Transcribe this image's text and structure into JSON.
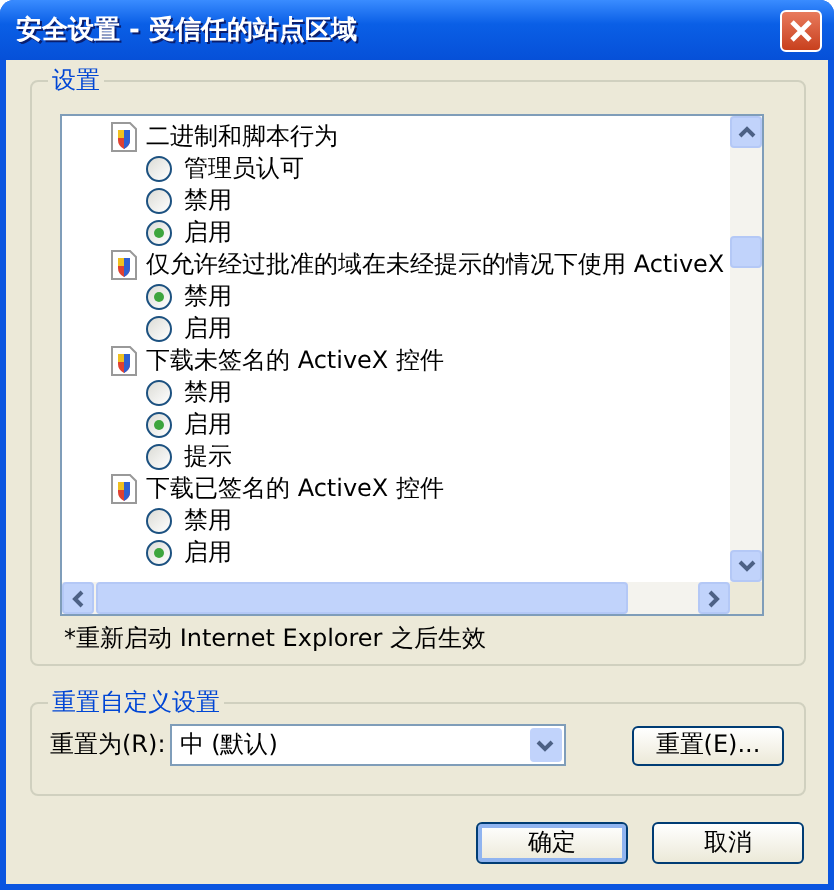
{
  "window": {
    "title": "安全设置 - 受信任的站点区域"
  },
  "settings_group": {
    "label": "设置",
    "items": [
      {
        "label": "二进制和脚本行为",
        "options": [
          {
            "label": "管理员认可",
            "selected": false
          },
          {
            "label": "禁用",
            "selected": false
          },
          {
            "label": "启用",
            "selected": true
          }
        ]
      },
      {
        "label": "仅允许经过批准的域在未经提示的情况下使用 ActiveX",
        "options": [
          {
            "label": "禁用",
            "selected": true
          },
          {
            "label": "启用",
            "selected": false
          }
        ]
      },
      {
        "label": "下载未签名的 ActiveX 控件",
        "options": [
          {
            "label": "禁用",
            "selected": false
          },
          {
            "label": "启用",
            "selected": true
          },
          {
            "label": "提示",
            "selected": false
          }
        ]
      },
      {
        "label": "下载已签名的 ActiveX 控件",
        "options": [
          {
            "label": "禁用",
            "selected": false
          },
          {
            "label": "启用",
            "selected": true
          }
        ]
      }
    ],
    "note": "*重新启动 Internet Explorer 之后生效"
  },
  "reset_group": {
    "label": "重置自定义设置",
    "reset_to_label": "重置为(R):",
    "reset_to_value": "中 (默认)",
    "reset_button": "重置(E)..."
  },
  "buttons": [
    {
      "label": "确定",
      "default": true
    },
    {
      "label": "取消",
      "default": false
    }
  ]
}
